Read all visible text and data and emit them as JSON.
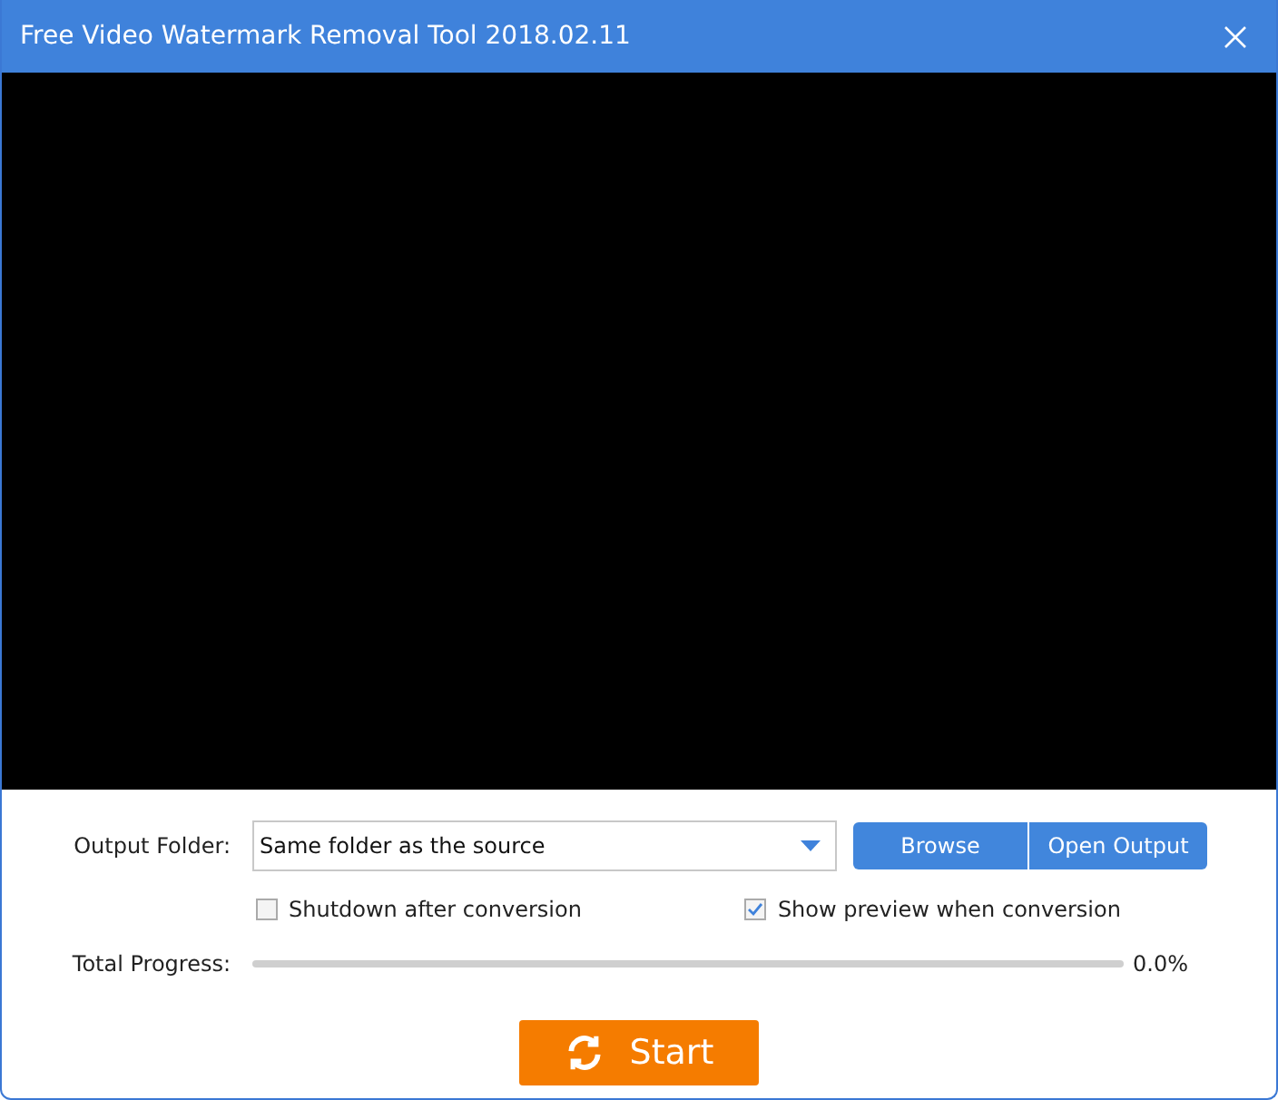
{
  "window": {
    "title": "Free Video Watermark Removal Tool 2018.02.11"
  },
  "output_folder": {
    "label": "Output Folder:",
    "value": "Same folder as the source"
  },
  "buttons": [
    "Browse",
    "Open Output"
  ],
  "options": [
    {
      "label": "Shutdown after conversion",
      "checked": false
    },
    {
      "label": "Show preview when conversion",
      "checked": true
    }
  ],
  "progress": {
    "label": "Total Progress:",
    "level": 0,
    "reading": "0.0%"
  },
  "start_button": {
    "label": "Start"
  }
}
